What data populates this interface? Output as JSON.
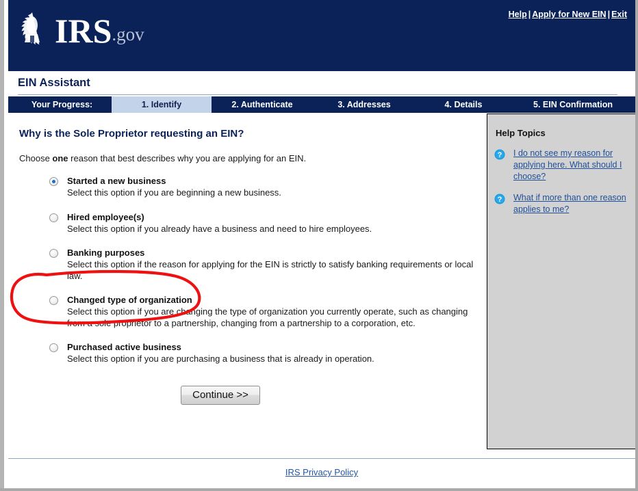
{
  "brand": {
    "logo_text": "IRS",
    "logo_suffix": ".gov",
    "seal_name": "irs-eagle-seal-icon",
    "navy": "#0b2259",
    "accent_light_blue": "#c3d3ea",
    "link_blue": "#2456a8",
    "annotation_color": "#ee1111"
  },
  "topnav": {
    "help": "Help",
    "apply": "Apply for New EIN",
    "exit": "Exit",
    "separator": "|"
  },
  "app": {
    "title": "EIN Assistant"
  },
  "progress": {
    "label": "Your Progress:",
    "steps": [
      {
        "label": "1. Identify",
        "active": true
      },
      {
        "label": "2. Authenticate",
        "active": false
      },
      {
        "label": "3. Addresses",
        "active": false
      },
      {
        "label": "4. Details",
        "active": false
      },
      {
        "label": "5. EIN Confirmation",
        "active": false
      }
    ]
  },
  "main": {
    "heading": "Why is the Sole Proprietor requesting an EIN?",
    "instruction_pre": "Choose ",
    "instruction_bold": "one",
    "instruction_post": " reason that best describes why you are applying for an EIN.",
    "options": [
      {
        "label": "Started a new business",
        "description": "Select this option if you are beginning a new business.",
        "selected": true
      },
      {
        "label": "Hired employee(s)",
        "description": "Select this option if you already have a business and need to hire employees.",
        "selected": false
      },
      {
        "label": "Banking purposes",
        "description": "Select this option if the reason for applying for the EIN is strictly to satisfy banking requirements or local law.",
        "selected": false
      },
      {
        "label": "Changed type of organization",
        "description": "Select this option if you are changing the type of organization you currently operate, such as changing from a sole proprietor to a partnership, changing from a partnership to a corporation, etc.",
        "selected": false
      },
      {
        "label": "Purchased active business",
        "description": "Select this option if you are purchasing a business that is already in operation.",
        "selected": false
      }
    ],
    "continue_label": "Continue >>"
  },
  "help": {
    "title": "Help Topics",
    "icon_name": "question-mark-icon",
    "items": [
      {
        "label": "I do not see my reason for applying here. What should I choose?"
      },
      {
        "label": "What if more than one reason applies to me?"
      }
    ]
  },
  "footer": {
    "privacy_label": "IRS Privacy Policy"
  },
  "annotation": {
    "shape": "hand-drawn-red-ellipse",
    "targets_option": "Started a new business"
  }
}
